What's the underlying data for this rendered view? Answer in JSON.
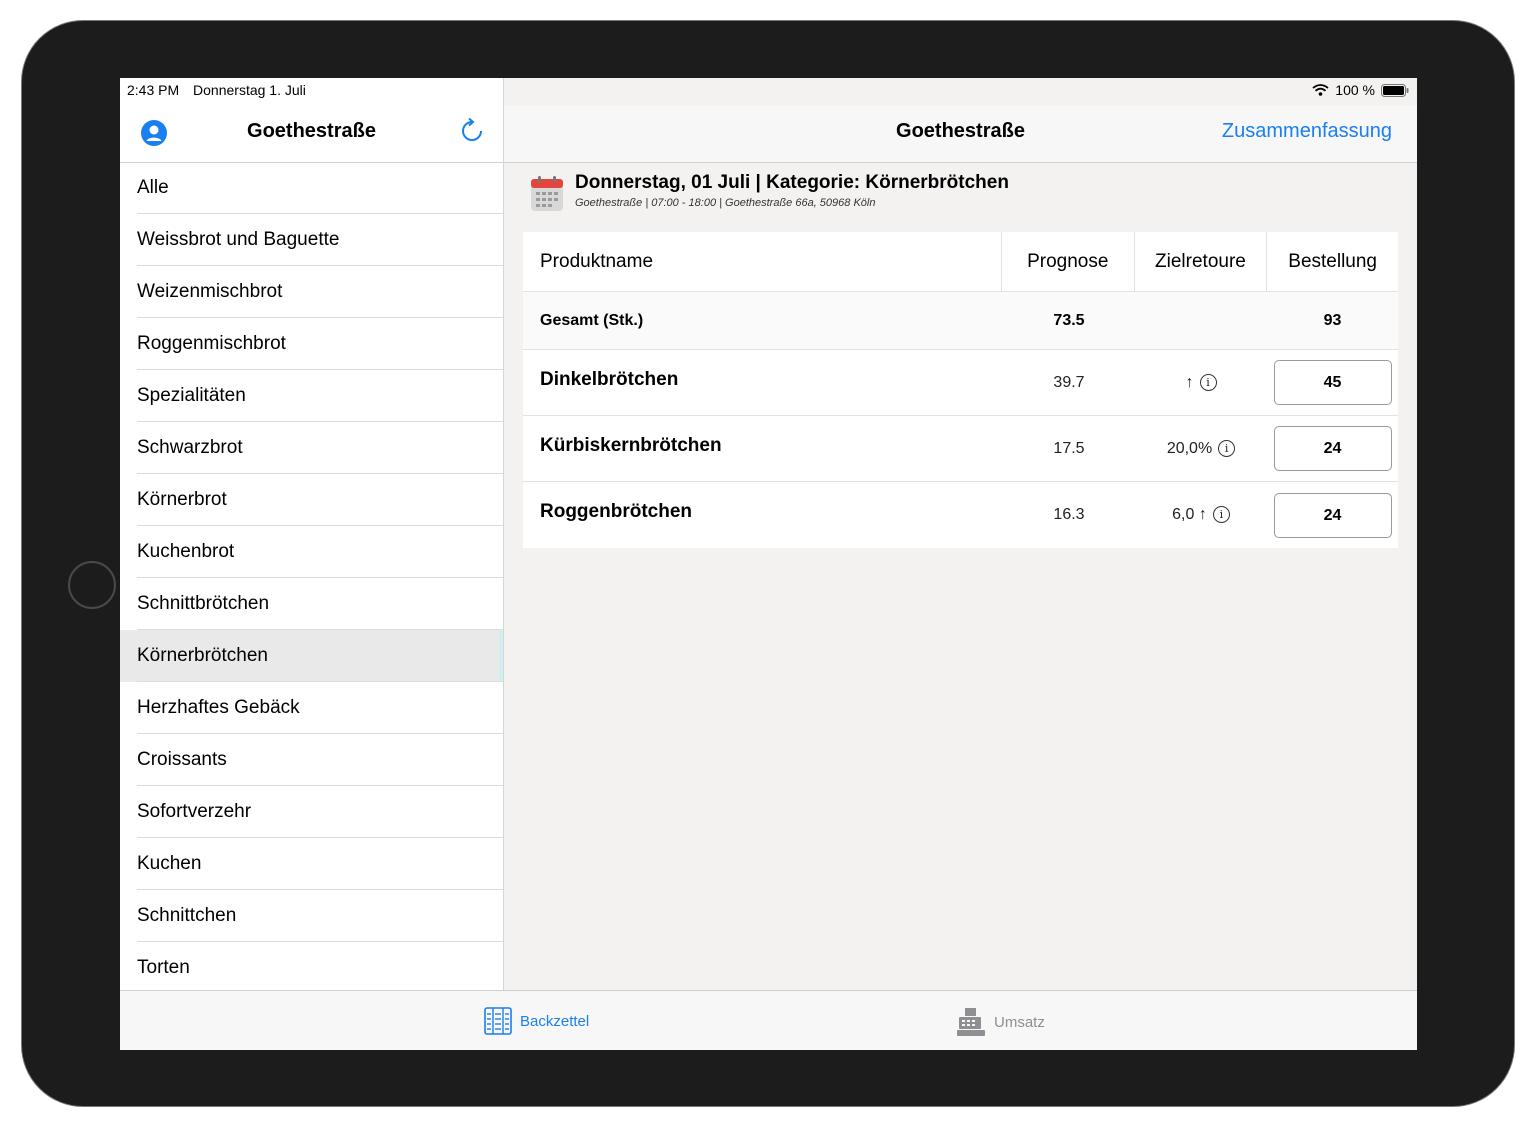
{
  "status": {
    "time": "2:43 PM",
    "date": "Donnerstag 1. Juli",
    "battery": "100 %"
  },
  "sidebar": {
    "title": "Goethestraße",
    "categories": [
      "Alle",
      "Weissbrot und Baguette",
      "Weizenmischbrot",
      "Roggenmischbrot",
      "Spezialitäten",
      "Schwarzbrot",
      "Körnerbrot",
      "Kuchenbrot",
      "Schnittbrötchen",
      "Körnerbrötchen",
      "Herzhaftes Gebäck",
      "Croissants",
      "Sofortverzehr",
      "Kuchen",
      "Schnittchen",
      "Torten"
    ],
    "selected": "Körnerbrötchen"
  },
  "detail": {
    "title": "Goethestraße",
    "summary_link": "Zusammenfassung",
    "heading": "Donnerstag, 01 Juli | Kategorie: Körnerbrötchen",
    "subheading": "Goethestraße | 07:00 - 18:00 | Goethestraße 66a, 50968 Köln",
    "table": {
      "headers": [
        "Produktname",
        "Prognose",
        "Zielretoure",
        "Bestellung"
      ],
      "total": {
        "label": "Gesamt (Stk.)",
        "prognose": "73.5",
        "bestellung": "93"
      },
      "rows": [
        {
          "name": "Dinkelbrötchen",
          "prognose": "39.7",
          "zielretoure": "↑",
          "bestellung": "45"
        },
        {
          "name": "Kürbiskernbrötchen",
          "prognose": "17.5",
          "zielretoure": "20,0%",
          "bestellung": "24"
        },
        {
          "name": "Roggenbrötchen",
          "prognose": "16.3",
          "zielretoure": "6,0 ↑",
          "bestellung": "24"
        }
      ]
    }
  },
  "tabbar": {
    "tabs": [
      {
        "label": "Backzettel",
        "icon": "list-icon",
        "active": true
      },
      {
        "label": "Umsatz",
        "icon": "cash-register-icon",
        "active": false
      }
    ]
  },
  "colors": {
    "accent": "#1a7ff0",
    "inactive": "#8e8e93",
    "calendar_red": "#e2453c"
  }
}
